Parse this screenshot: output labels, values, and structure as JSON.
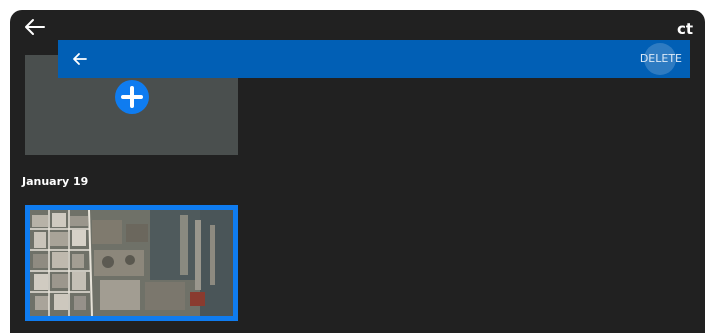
{
  "top_bar": {
    "back_icon": "arrow-left-icon",
    "action_label": "ct"
  },
  "upload": {
    "icon": "plus-circle-icon"
  },
  "gallery": {
    "date_label": "January 19",
    "photo": {
      "icon": "aerial-map-photo"
    }
  },
  "selection_bar": {
    "back_icon": "arrow-left-icon",
    "delete_label": "DELETE"
  },
  "colors": {
    "background": "#212121",
    "selection_bar": "#015fb5",
    "accent": "#0f7cf0",
    "tile": "#4a4f4e"
  }
}
